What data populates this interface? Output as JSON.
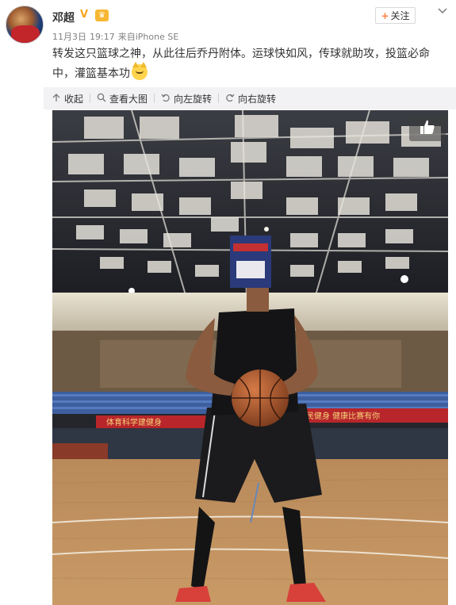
{
  "post": {
    "username": "邓超",
    "verified_badge": "V",
    "member_badge": "👑",
    "date": "11月3日",
    "time": "19:17",
    "source_prefix": "来自",
    "source": "iPhone SE",
    "text": "转发这只篮球之神，从此往后乔丹附体。运球快如风，传球就助攻，投篮必命中，灌篮基本功",
    "emoji": "doge-cat-emoji"
  },
  "follow": {
    "plus": "+",
    "label": "关注"
  },
  "toolbar": {
    "collapse": "收起",
    "view_large": "查看大图",
    "rotate_left": "向左旋转",
    "rotate_right": "向右旋转"
  },
  "photo": {
    "banner_left": "体育科学建健身",
    "banner_right": "全民健身  健康比赛有你"
  },
  "icons": {
    "collapse": "arrow-up-icon",
    "view_large": "magnifier-icon",
    "rotate_left": "rotate-left-icon",
    "rotate_right": "rotate-right-icon",
    "like": "thumbs-up-icon"
  },
  "colors": {
    "follow_plus": "#ff8140",
    "verified": "#f5a623",
    "toolbar_bg": "#f2f2f5",
    "meta_text": "#808080"
  }
}
